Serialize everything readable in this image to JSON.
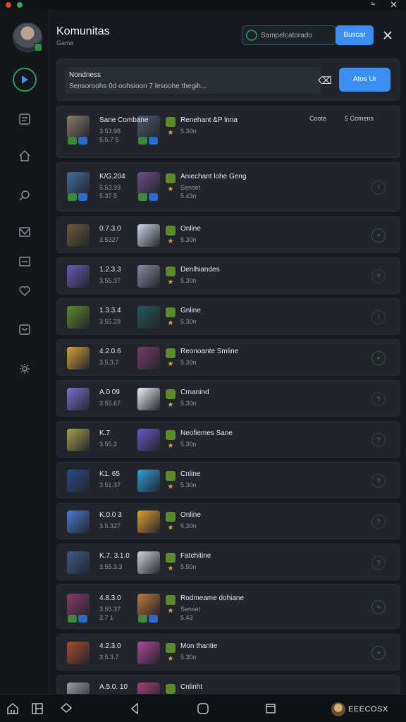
{
  "app": {
    "title": "Komunitas",
    "subtitle": "Game",
    "search_placeholder": "Sampelcatorado",
    "search_button": "Buscar"
  },
  "notice": {
    "title": "Nondness",
    "text": "Sensoroohs 0d oohsioon 7 lesoohe thegih...",
    "button": "Atos Ur"
  },
  "filters": {
    "option1": "Coote",
    "option2": "5 Comens"
  },
  "colors": {
    "accent": "#3b8ff0",
    "active": "#2c9a5a",
    "panel": "#22252b",
    "background": "#17191e"
  },
  "rows": [
    {
      "name": "Sane Combane",
      "stat1": "3.53.98",
      "stat2": "5.5.7 5",
      "game": "Renehant &P lnna",
      "meta": "5.30n",
      "status": ""
    },
    {
      "name": "K/G.204",
      "stat1": "5.53.93",
      "stat2": "5.37 5",
      "game": "Aniechant lohe Geng",
      "meta": "Senset",
      "meta2": "5.43n",
      "status": "!"
    },
    {
      "name": "0.7.3.0",
      "stat1": "3.5327",
      "stat2": "",
      "game": "Online",
      "meta": "5.30n",
      "status": "+"
    },
    {
      "name": "1.2.3.3",
      "stat1": "3.55.37",
      "stat2": "",
      "game": "Denlhiandes",
      "meta": "5.30n",
      "status": "?"
    },
    {
      "name": "1.3.3.4",
      "stat1": "3.55.29",
      "stat2": "",
      "game": "Gnline",
      "meta": "5.30n",
      "status": "!"
    },
    {
      "name": "4.2.0.6",
      "stat1": "3.5.3.7",
      "stat2": "",
      "game": "Reonoante Smline",
      "meta": "5.30n",
      "status": "+"
    },
    {
      "name": "A.0 09",
      "stat1": "3.55.67",
      "stat2": "",
      "game": "Crnanind",
      "meta": "5.30n",
      "status": "?"
    },
    {
      "name": "K.7",
      "stat1": "3.55.2",
      "stat2": "",
      "game": "Neofiemes Sane",
      "meta": "5.30n",
      "status": "?"
    },
    {
      "name": "K1. 65",
      "stat1": "3.51.37",
      "stat2": "",
      "game": "Cnline",
      "meta": "5.30n",
      "status": "?"
    },
    {
      "name": "K.0.0 3",
      "stat1": "3.5.327",
      "stat2": "",
      "game": "Online",
      "meta": "5.30n",
      "status": "?"
    },
    {
      "name": "K.7. 3.1.0",
      "stat1": "3.55.3.3",
      "stat2": "",
      "game": "Fatchitine",
      "meta": "5.50n",
      "status": "?"
    },
    {
      "name": "4.8.3.0",
      "stat1": "3.55.37",
      "stat2": "3.7 1",
      "game": "Rodmeame dohiane",
      "meta": "Senset",
      "meta2": "5.43",
      "status": "+"
    },
    {
      "name": "4.2.3.0",
      "stat1": "3.5.3.7",
      "stat2": "",
      "game": "Mon thantie",
      "meta": "5.30n",
      "status": "+"
    },
    {
      "name": "A.5.0. 10",
      "stat1": "",
      "stat2": "",
      "game": "Cnlinht",
      "meta": "",
      "status": ""
    }
  ],
  "navbar": {
    "brand": "EEECOSX",
    "items": [
      "home-icon",
      "apps-icon",
      "chat-icon",
      "back-icon",
      "home-circle-icon",
      "recents-icon"
    ]
  }
}
